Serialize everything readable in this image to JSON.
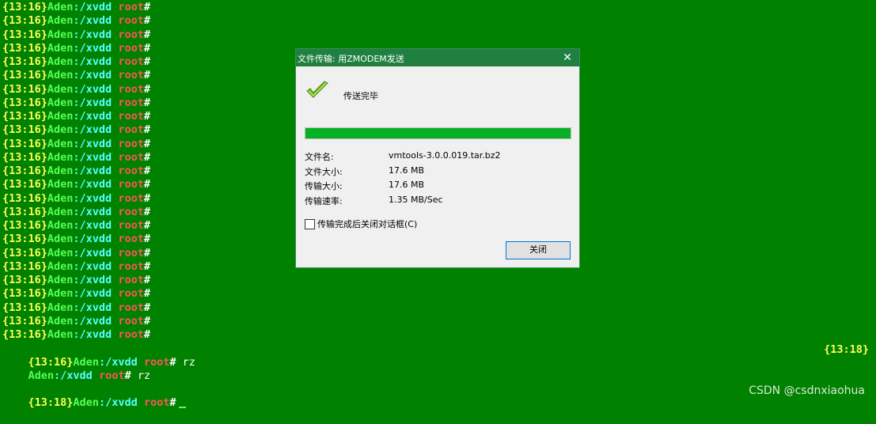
{
  "terminal": {
    "time": "{13:16}",
    "host": "Aden",
    "path": ":/xvdd",
    "user": "root",
    "hash": "#",
    "repeated_prompt_count": 25,
    "rz_line": {
      "time": "{13:16}",
      "host": "Aden",
      "path": ":/xvdd",
      "user": "root",
      "hash": "#",
      "command": " rz"
    },
    "right_time": "{13:18}",
    "rz_echo": {
      "host": "Aden",
      "path": ":/xvdd",
      "user": "root",
      "hash": "#",
      "command": " rz"
    },
    "last_prompt": {
      "time": "{13:18}",
      "host": "Aden",
      "path": ":/xvdd",
      "user": "root",
      "hash": "#"
    }
  },
  "dialog": {
    "title": "文件传输: 用ZMODEM发送",
    "close_icon": "✕",
    "status_icon": "checkmark-icon",
    "status": "传送完毕",
    "progress_percent": 100,
    "rows": [
      {
        "label": "文件名:",
        "value": "vmtools-3.0.0.019.tar.bz2"
      },
      {
        "label": "文件大小:",
        "value": "17.6 MB"
      },
      {
        "label": "传输大小:",
        "value": "17.6 MB"
      },
      {
        "label": "传输速率:",
        "value": "1.35 MB/Sec"
      }
    ],
    "auto_close_label": "传输完成后关闭对话框(C)",
    "auto_close_checked": false,
    "close_button": "关闭"
  },
  "watermark": "CSDN @csdnxiaohua",
  "colors": {
    "background": "#008200",
    "time": "#ffff55",
    "host": "#55ff55",
    "path": "#55ffff",
    "user": "#ff5555",
    "titlebar": "#208040",
    "progress": "#06b025"
  }
}
